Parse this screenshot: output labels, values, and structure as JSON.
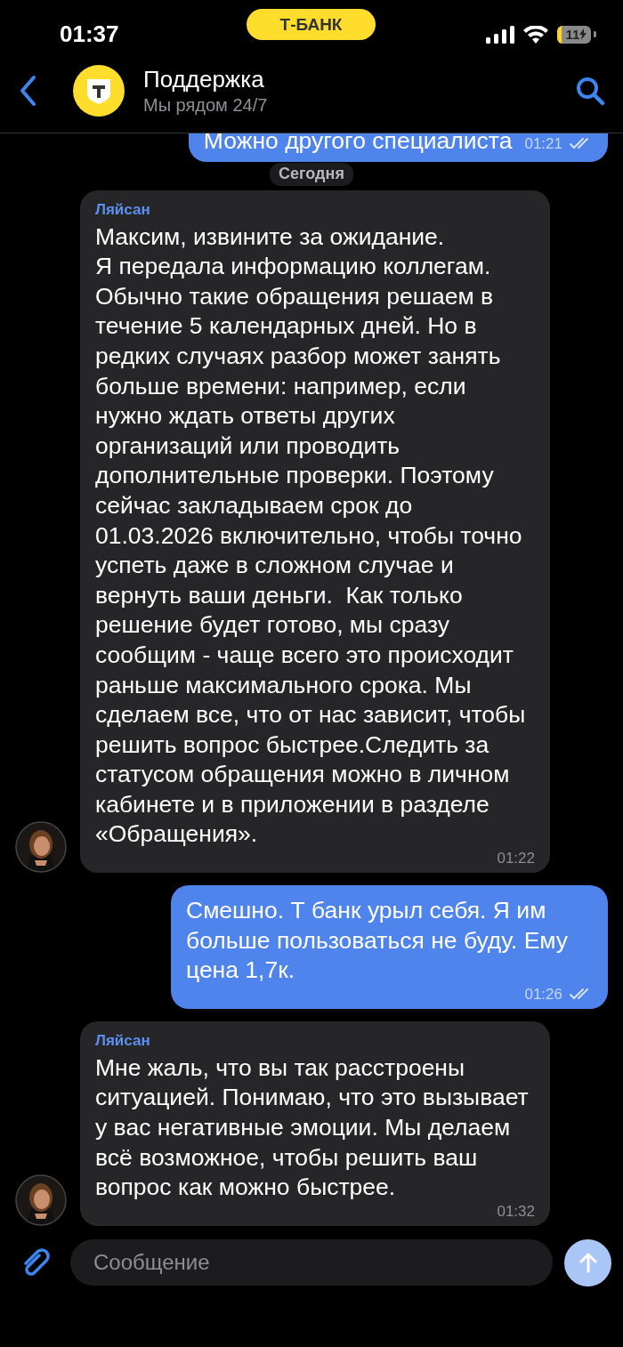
{
  "status_bar": {
    "time": "01:37",
    "operator_badge": "Т-БАНК",
    "battery": "11"
  },
  "header": {
    "title": "Поддержка",
    "subtitle": "Мы рядом 24/7"
  },
  "date_label": "Сегодня",
  "messages": [
    {
      "kind": "outgoing",
      "text": "Можно другого специалиста",
      "time": "01:21",
      "read": true
    },
    {
      "kind": "incoming",
      "sender": "Ляйсан",
      "text": "Максим, извините за ожидание.\nЯ передала информацию коллегам. Обычно такие обращения решаем в течение 5 календарных дней. Но в редких случаях разбор может занять больше времени: например, если нужно ждать ответы других организаций или проводить дополнительные проверки. Поэтому сейчас закладываем срок до 01.03.2026 включительно, чтобы точно успеть даже в сложном случае и вернуть ваши деньги.  Как только решение будет готово, мы сразу сообщим - чаще всего это происходит раньше максимального срока. Мы сделаем все, что от нас зависит, чтобы решить вопрос быстрее.Следить за статусом обращения можно в личном кабинете и в приложении в разделе «Обращения».",
      "time": "01:22"
    },
    {
      "kind": "outgoing",
      "text": "Смешно. Т банк урыл себя. Я им больше пользоваться не буду. Ему цена 1,7к.",
      "time": "01:26",
      "read": true
    },
    {
      "kind": "incoming",
      "sender": "Ляйсан",
      "text": "Мне жаль, что вы так расстроены ситуацией. Понимаю, что это вызывает у вас негативные эмоции. Мы делаем всё возможное, чтобы решить ваш вопрос как можно быстрее.",
      "time": "01:32"
    }
  ],
  "composer": {
    "placeholder": "Сообщение",
    "send_disabled": true
  }
}
